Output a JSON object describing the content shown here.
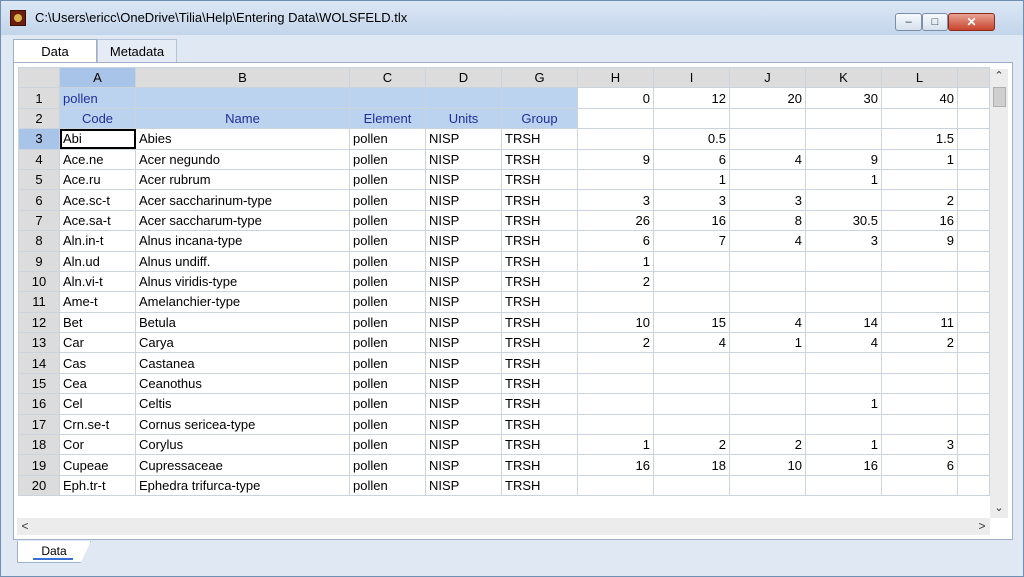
{
  "window": {
    "title": "C:\\Users\\ericc\\OneDrive\\Tilia\\Help\\Entering Data\\WOLSFELD.tlx",
    "icon": "tilia-app-icon",
    "controls": {
      "minimize": "–",
      "maximize": "□",
      "close": "✕"
    }
  },
  "tabs": [
    {
      "label": "Data",
      "active": true
    },
    {
      "label": "Metadata",
      "active": false
    }
  ],
  "grid": {
    "columns": [
      "A",
      "B",
      "C",
      "D",
      "G",
      "H",
      "I",
      "J",
      "K",
      "L"
    ],
    "rows": [
      {
        "n": "1",
        "cells": [
          "pollen",
          "",
          "",
          "",
          "",
          "0",
          "12",
          "20",
          "30",
          "40"
        ]
      },
      {
        "n": "2",
        "cells": [
          "Code",
          "Name",
          "Element",
          "Units",
          "Group",
          "",
          "",
          "",
          "",
          ""
        ]
      },
      {
        "n": "3",
        "cells": [
          "Abi",
          "Abies",
          "pollen",
          "NISP",
          "TRSH",
          "",
          "0.5",
          "",
          "",
          "1.5"
        ]
      },
      {
        "n": "4",
        "cells": [
          "Ace.ne",
          "Acer negundo",
          "pollen",
          "NISP",
          "TRSH",
          "9",
          "6",
          "4",
          "9",
          "1"
        ]
      },
      {
        "n": "5",
        "cells": [
          "Ace.ru",
          "Acer rubrum",
          "pollen",
          "NISP",
          "TRSH",
          "",
          "1",
          "",
          "1",
          ""
        ]
      },
      {
        "n": "6",
        "cells": [
          "Ace.sc-t",
          "Acer saccharinum-type",
          "pollen",
          "NISP",
          "TRSH",
          "3",
          "3",
          "3",
          "",
          "2"
        ]
      },
      {
        "n": "7",
        "cells": [
          "Ace.sa-t",
          "Acer saccharum-type",
          "pollen",
          "NISP",
          "TRSH",
          "26",
          "16",
          "8",
          "30.5",
          "16"
        ]
      },
      {
        "n": "8",
        "cells": [
          "Aln.in-t",
          "Alnus incana-type",
          "pollen",
          "NISP",
          "TRSH",
          "6",
          "7",
          "4",
          "3",
          "9"
        ]
      },
      {
        "n": "9",
        "cells": [
          "Aln.ud",
          "Alnus undiff.",
          "pollen",
          "NISP",
          "TRSH",
          "1",
          "",
          "",
          "",
          ""
        ]
      },
      {
        "n": "10",
        "cells": [
          "Aln.vi-t",
          "Alnus viridis-type",
          "pollen",
          "NISP",
          "TRSH",
          "2",
          "",
          "",
          "",
          ""
        ]
      },
      {
        "n": "11",
        "cells": [
          "Ame-t",
          "Amelanchier-type",
          "pollen",
          "NISP",
          "TRSH",
          "",
          "",
          "",
          "",
          ""
        ]
      },
      {
        "n": "12",
        "cells": [
          "Bet",
          "Betula",
          "pollen",
          "NISP",
          "TRSH",
          "10",
          "15",
          "4",
          "14",
          "11"
        ]
      },
      {
        "n": "13",
        "cells": [
          "Car",
          "Carya",
          "pollen",
          "NISP",
          "TRSH",
          "2",
          "4",
          "1",
          "4",
          "2"
        ]
      },
      {
        "n": "14",
        "cells": [
          "Cas",
          "Castanea",
          "pollen",
          "NISP",
          "TRSH",
          "",
          "",
          "",
          "",
          ""
        ]
      },
      {
        "n": "15",
        "cells": [
          "Cea",
          "Ceanothus",
          "pollen",
          "NISP",
          "TRSH",
          "",
          "",
          "",
          "",
          ""
        ]
      },
      {
        "n": "16",
        "cells": [
          "Cel",
          "Celtis",
          "pollen",
          "NISP",
          "TRSH",
          "",
          "",
          "",
          "1",
          ""
        ]
      },
      {
        "n": "17",
        "cells": [
          "Crn.se-t",
          "Cornus sericea-type",
          "pollen",
          "NISP",
          "TRSH",
          "",
          "",
          "",
          "",
          ""
        ]
      },
      {
        "n": "18",
        "cells": [
          "Cor",
          "Corylus",
          "pollen",
          "NISP",
          "TRSH",
          "1",
          "2",
          "2",
          "1",
          "3"
        ]
      },
      {
        "n": "19",
        "cells": [
          "Cupeae",
          "Cupressaceae",
          "pollen",
          "NISP",
          "TRSH",
          "16",
          "18",
          "10",
          "16",
          "6"
        ]
      },
      {
        "n": "20",
        "cells": [
          "Eph.tr-t",
          "Ephedra trifurca-type",
          "pollen",
          "NISP",
          "TRSH",
          "",
          "",
          "",
          "",
          ""
        ]
      }
    ]
  },
  "scroll": {
    "up": "⌃",
    "down": "⌄",
    "left": "<",
    "right": ">"
  },
  "sheet_tabs": [
    {
      "label": "Data"
    }
  ],
  "colors": {
    "selection_header": "#a8c4e8",
    "blue_cells": "#bcd3f0",
    "blue_text": "#1f2f9a"
  }
}
